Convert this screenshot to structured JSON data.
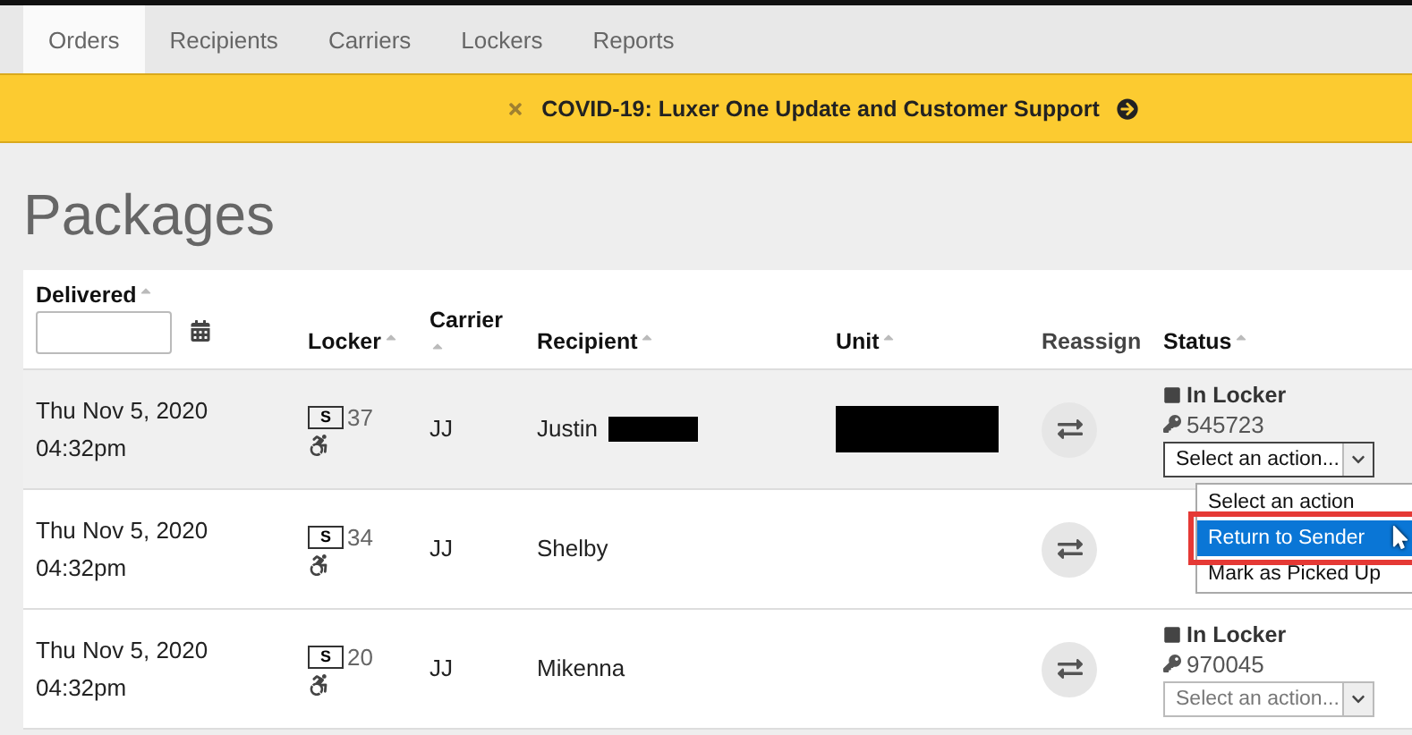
{
  "tabs": [
    {
      "label": "Orders",
      "selected": true
    },
    {
      "label": "Recipients",
      "selected": false
    },
    {
      "label": "Carriers",
      "selected": false
    },
    {
      "label": "Lockers",
      "selected": false
    },
    {
      "label": "Reports",
      "selected": false
    }
  ],
  "banner": {
    "text": "COVID-19: Luxer One Update and Customer Support"
  },
  "title": "Packages",
  "columns": [
    "Delivered",
    "Locker",
    "Carrier",
    "Recipient",
    "Unit",
    "Reassign",
    "Status"
  ],
  "rows": [
    {
      "date": "Thu Nov 5, 2020",
      "time": "04:32pm",
      "size": "S",
      "locker": "37",
      "carrier": "JJ",
      "recipient": "Justin",
      "recipient_redacted": true,
      "unit_redacted": true,
      "highlighted": true,
      "status": "In Locker",
      "code": "545723",
      "action": "Select an action...",
      "open": true,
      "options": [
        {
          "label": "Select an action",
          "selected": false
        },
        {
          "label": "Return to Sender",
          "selected": true
        },
        {
          "label": "Mark as Picked Up",
          "selected": false
        }
      ]
    },
    {
      "date": "Thu Nov 5, 2020",
      "time": "04:32pm",
      "size": "S",
      "locker": "34",
      "carrier": "JJ",
      "recipient": "Shelby",
      "recipient_redacted": false,
      "unit_redacted": false,
      "highlighted": false
    },
    {
      "date": "Thu Nov 5, 2020",
      "time": "04:32pm",
      "size": "S",
      "locker": "20",
      "carrier": "JJ",
      "recipient": "Mikenna",
      "recipient_redacted": false,
      "unit_redacted": false,
      "highlighted": false,
      "status": "In Locker",
      "code": "970045",
      "action": "Select an action...",
      "open": false
    }
  ]
}
